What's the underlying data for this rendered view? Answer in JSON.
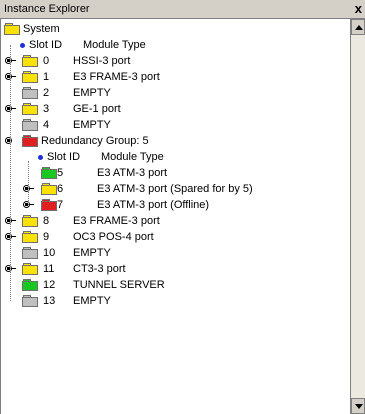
{
  "window": {
    "title": "Instance Explorer",
    "close_label": "x"
  },
  "colors": {
    "yellow": "#ffe100",
    "gray": "#c0c0c0",
    "green": "#18c820",
    "red": "#e02020",
    "bullet": "#1e2fd8"
  },
  "tree": {
    "root": {
      "label": "System"
    },
    "header": {
      "id_label": "Slot ID",
      "type_label": "Module Type"
    },
    "slots": [
      {
        "id": "0",
        "type": "HSSI-3 port",
        "color": "yellow",
        "expandable": true
      },
      {
        "id": "1",
        "type": "E3 FRAME-3 port",
        "color": "yellow",
        "expandable": true
      },
      {
        "id": "2",
        "type": "EMPTY",
        "color": "gray",
        "expandable": false
      },
      {
        "id": "3",
        "type": "GE-1 port",
        "color": "yellow",
        "expandable": true
      },
      {
        "id": "4",
        "type": "EMPTY",
        "color": "gray",
        "expandable": false
      }
    ],
    "group": {
      "label": "Redundancy Group: 5",
      "header": {
        "id_label": "Slot ID",
        "type_label": "Module Type"
      },
      "slots": [
        {
          "id": "5",
          "type": "E3 ATM-3 port",
          "color": "green",
          "expandable": false
        },
        {
          "id": "6",
          "type": "E3 ATM-3 port (Spared for by 5)",
          "color": "yellow",
          "expandable": true
        },
        {
          "id": "7",
          "type": "E3 ATM-3 port (Offline)",
          "color": "red",
          "expandable": true
        }
      ]
    },
    "slots_after": [
      {
        "id": "8",
        "type": "E3 FRAME-3 port",
        "color": "yellow",
        "expandable": true
      },
      {
        "id": "9",
        "type": "OC3 POS-4 port",
        "color": "yellow",
        "expandable": true
      },
      {
        "id": "10",
        "type": "EMPTY",
        "color": "gray",
        "expandable": false
      },
      {
        "id": "11",
        "type": "CT3-3 port",
        "color": "yellow",
        "expandable": true
      },
      {
        "id": "12",
        "type": "TUNNEL SERVER",
        "color": "green",
        "expandable": false
      },
      {
        "id": "13",
        "type": "EMPTY",
        "color": "gray",
        "expandable": false
      }
    ]
  }
}
